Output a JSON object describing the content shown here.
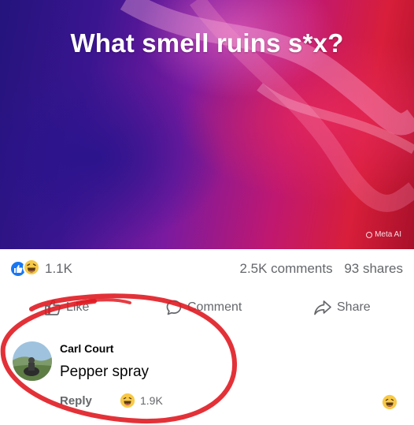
{
  "post": {
    "title": "What smell ruins s*x?",
    "watermark": "Meta AI"
  },
  "stats": {
    "reactions_count": "1.1K",
    "comments": "2.5K comments",
    "shares": "93 shares"
  },
  "actions": {
    "like": "Like",
    "comment": "Comment",
    "share": "Share"
  },
  "comment": {
    "author": "Carl Court",
    "text": "Pepper spray",
    "reply_label": "Reply",
    "reaction_count": "1.9K"
  },
  "colors": {
    "like_blue": "#1877f2",
    "haha_yellow": "#f7c948",
    "annotation_red": "#e01b22",
    "secondary_text": "#65676b"
  },
  "icons": [
    "like-reaction-icon",
    "haha-reaction-icon",
    "thumbs-up-icon",
    "comment-icon",
    "share-icon",
    "meta-ai-icon"
  ]
}
